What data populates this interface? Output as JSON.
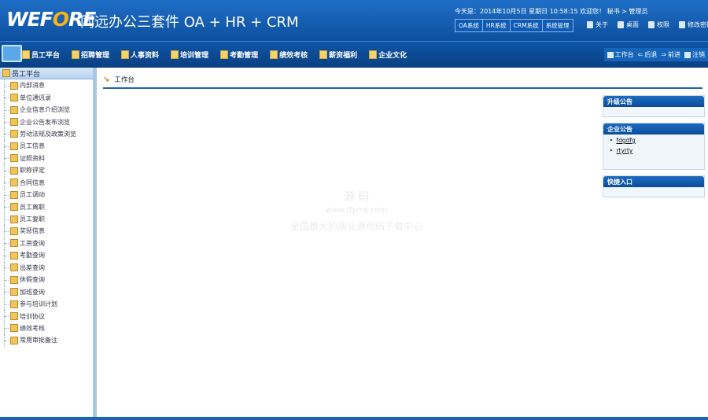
{
  "header": {
    "logo_prefix": "WEF",
    "logo_o": "O",
    "logo_suffix": "RE",
    "title": "同远办公三套件 OA + HR + CRM",
    "info": "今天是：2014年10月5日  星期日  10:58:15  欢迎您！ 秘书 > 管理员",
    "systems": [
      "OA系统",
      "HR系统",
      "CRM系统",
      "系统管理"
    ],
    "links": [
      "关于",
      "桌面",
      "权限",
      "修改密码"
    ]
  },
  "nav": {
    "items": [
      "员工平台",
      "招聘管理",
      "人事资料",
      "培训管理",
      "考勤管理",
      "绩效考核",
      "薪资福利",
      "企业文化"
    ],
    "right": [
      "工作台",
      "后退",
      "前进",
      "注销"
    ]
  },
  "sidebar": {
    "title": "员工平台",
    "items": [
      "内部消息",
      "单位通讯录",
      "企业信息介绍浏览",
      "企业公告发布浏览",
      "劳动法规及政策浏览",
      "员工信息",
      "证照资料",
      "职称评定",
      "合同信息",
      "员工调动",
      "员工离职",
      "员工复职",
      "奖惩信息",
      "工资查询",
      "考勤查询",
      "出差查询",
      "休假查询",
      "加班查询",
      "参与培训计划",
      "培训协议",
      "绩效考核",
      "常用审批备注"
    ]
  },
  "main": {
    "crumb_icon": "↘",
    "crumb": "工作台",
    "panels": {
      "upgrade_title": "升级公告",
      "company_title": "企业公告",
      "company_items": [
        "fdgdfg",
        "rtyrty"
      ],
      "quick_title": "快捷入口"
    },
    "watermark": {
      "logo": "源 码",
      "url": "www.ffyms.com",
      "text": "全国最大的商业源代码下载中心"
    }
  }
}
